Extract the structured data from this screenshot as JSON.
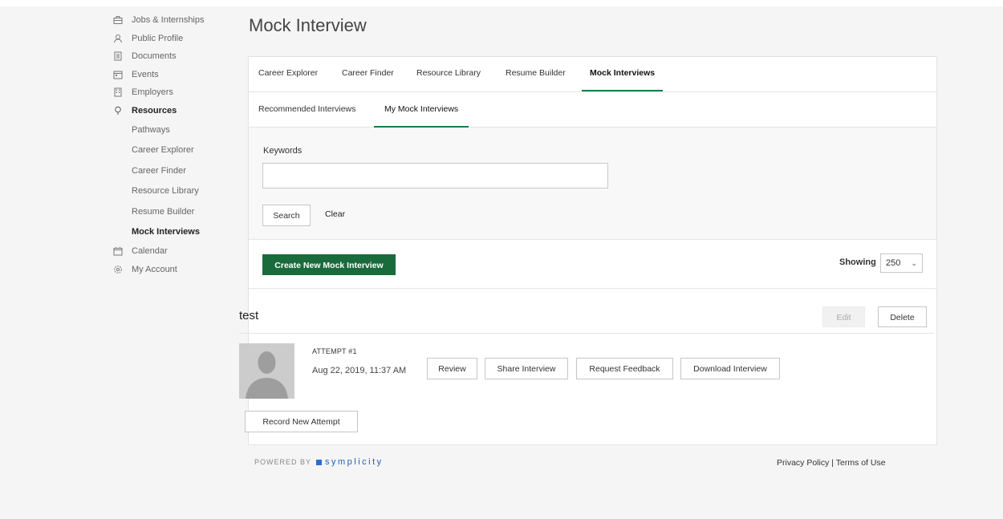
{
  "sidebar": {
    "items": [
      {
        "label": "Jobs & Internships",
        "icon": "briefcase-icon"
      },
      {
        "label": "Public Profile",
        "icon": "person-icon"
      },
      {
        "label": "Documents",
        "icon": "document-icon"
      },
      {
        "label": "Events",
        "icon": "calendar-event-icon"
      },
      {
        "label": "Employers",
        "icon": "building-icon"
      },
      {
        "label": "Resources",
        "icon": "lightbulb-icon",
        "active": true
      }
    ],
    "sub_items": [
      {
        "label": "Pathways"
      },
      {
        "label": "Career Explorer"
      },
      {
        "label": "Career Finder"
      },
      {
        "label": "Resource Library"
      },
      {
        "label": "Resume Builder"
      },
      {
        "label": "Mock Interviews",
        "active": true
      }
    ],
    "bottom_items": [
      {
        "label": "Calendar",
        "icon": "calendar-icon"
      },
      {
        "label": "My Account",
        "icon": "gear-icon"
      }
    ]
  },
  "page": {
    "title": "Mock Interview"
  },
  "tabs": [
    {
      "label": "Career Explorer"
    },
    {
      "label": "Career Finder"
    },
    {
      "label": "Resource Library"
    },
    {
      "label": "Resume Builder"
    },
    {
      "label": "Mock Interviews",
      "active": true
    }
  ],
  "subtabs": [
    {
      "label": "Recommended Interviews"
    },
    {
      "label": "My Mock Interviews",
      "active": true
    }
  ],
  "filters": {
    "keywords_label": "Keywords",
    "keywords_value": "",
    "search_label": "Search",
    "clear_label": "Clear"
  },
  "actions": {
    "create_label": "Create New Mock Interview",
    "showing_label": "Showing",
    "showing_value": "250"
  },
  "interview": {
    "title": "test",
    "edit_label": "Edit",
    "delete_label": "Delete",
    "attempt_label": "ATTEMPT #1",
    "attempt_date": "Aug 22, 2019, 11:37 AM",
    "review_label": "Review",
    "share_label": "Share Interview",
    "feedback_label": "Request Feedback",
    "download_label": "Download Interview",
    "record_label": "Record New Attempt"
  },
  "footer": {
    "powered_by": "POWERED BY",
    "brand": "symplicity",
    "privacy_label": "Privacy Policy",
    "separator": "|",
    "terms_label": "Terms of Use"
  },
  "colors": {
    "accent": "#1a6b3c",
    "tab_underline": "#1f7a4a",
    "brand_blue": "#1e5fb8"
  }
}
